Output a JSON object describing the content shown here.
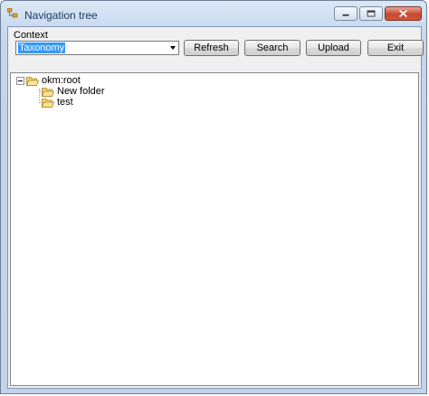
{
  "window": {
    "title": "Navigation tree",
    "app_icon": "tree-app-icon",
    "caption_buttons": [
      "minimize",
      "maximize",
      "close"
    ]
  },
  "context": {
    "label": "Context",
    "selected": "Taxonomy"
  },
  "toolbar": {
    "refresh_label": "Refresh",
    "search_label": "Search",
    "upload_label": "Upload",
    "exit_label": "Exit"
  },
  "tree": {
    "root": {
      "label": "okm:root",
      "expanded": true,
      "icon": "folder-open-icon"
    },
    "children": [
      {
        "label": "New folder",
        "icon": "folder-open-icon"
      },
      {
        "label": "test",
        "icon": "folder-open-icon"
      }
    ]
  },
  "colors": {
    "selection": "#3399ff",
    "folder": "#f0c040"
  }
}
